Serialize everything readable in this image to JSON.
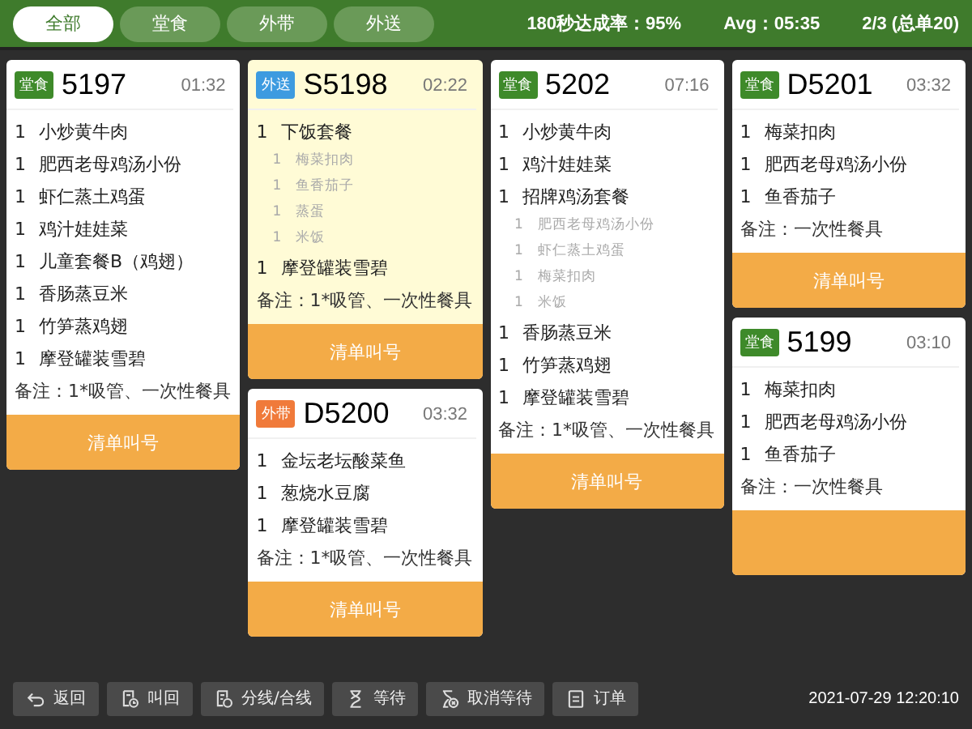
{
  "tabs": [
    {
      "label": "全部",
      "selected": true
    },
    {
      "label": "堂食",
      "selected": false
    },
    {
      "label": "外带",
      "selected": false
    },
    {
      "label": "外送",
      "selected": false
    }
  ],
  "stats": [
    "180秒达成率：95%",
    "Avg：05:35",
    "2/3 (总单20)"
  ],
  "columns": [
    {
      "cards": [
        {
          "tag": "堂食",
          "color": "#3e8a2a",
          "number": "5197",
          "time": "01:32",
          "selected": false,
          "items": [
            {
              "qty": "1",
              "name": "小炒黄牛肉"
            },
            {
              "qty": "1",
              "name": "肥西老母鸡汤小份"
            },
            {
              "qty": "1",
              "name": "虾仁蒸土鸡蛋"
            },
            {
              "qty": "1",
              "name": "鸡汁娃娃菜"
            },
            {
              "qty": "1",
              "name": "儿童套餐B（鸡翅）"
            },
            {
              "qty": "1",
              "name": "香肠蒸豆米"
            },
            {
              "qty": "1",
              "name": "竹笋蒸鸡翅"
            },
            {
              "qty": "1",
              "name": "摩登罐装雪碧"
            }
          ],
          "note": "备注：1*吸管、一次性餐具",
          "button": "清单叫号"
        }
      ]
    },
    {
      "cards": [
        {
          "tag": "外送",
          "color": "#3d9be0",
          "number": "S5198",
          "time": "02:22",
          "selected": true,
          "items": [
            {
              "qty": "1",
              "name": "下饭套餐",
              "children": [
                {
                  "qty": "1",
                  "name": "梅菜扣肉"
                },
                {
                  "qty": "1",
                  "name": "鱼香茄子"
                },
                {
                  "qty": "1",
                  "name": "蒸蛋"
                },
                {
                  "qty": "1",
                  "name": "米饭"
                }
              ]
            },
            {
              "qty": "1",
              "name": "摩登罐装雪碧"
            }
          ],
          "note": "备注：1*吸管、一次性餐具",
          "button": "清单叫号"
        },
        {
          "tag": "外带",
          "color": "#f07a3a",
          "number": "D5200",
          "time": "03:32",
          "selected": false,
          "items": [
            {
              "qty": "1",
              "name": "金坛老坛酸菜鱼"
            },
            {
              "qty": "1",
              "name": "葱烧水豆腐"
            },
            {
              "qty": "1",
              "name": "摩登罐装雪碧"
            }
          ],
          "note": "备注：1*吸管、一次性餐具",
          "button": "清单叫号"
        }
      ]
    },
    {
      "cards": [
        {
          "tag": "堂食",
          "color": "#3e8a2a",
          "number": "5202",
          "time": "07:16",
          "selected": false,
          "items": [
            {
              "qty": "1",
              "name": "小炒黄牛肉"
            },
            {
              "qty": "1",
              "name": "鸡汁娃娃菜"
            },
            {
              "qty": "1",
              "name": "招牌鸡汤套餐",
              "children": [
                {
                  "qty": "1",
                  "name": "肥西老母鸡汤小份"
                },
                {
                  "qty": "1",
                  "name": "虾仁蒸土鸡蛋"
                },
                {
                  "qty": "1",
                  "name": "梅菜扣肉"
                },
                {
                  "qty": "1",
                  "name": "米饭"
                }
              ]
            },
            {
              "qty": "1",
              "name": "香肠蒸豆米"
            },
            {
              "qty": "1",
              "name": "竹笋蒸鸡翅"
            },
            {
              "qty": "1",
              "name": "摩登罐装雪碧"
            }
          ],
          "note": "备注：1*吸管、一次性餐具",
          "button": "清单叫号"
        }
      ]
    },
    {
      "cards": [
        {
          "tag": "堂食",
          "color": "#3e8a2a",
          "number": "D5201",
          "time": "03:32",
          "selected": false,
          "items": [
            {
              "qty": "1",
              "name": "梅菜扣肉"
            },
            {
              "qty": "1",
              "name": "肥西老母鸡汤小份"
            },
            {
              "qty": "1",
              "name": "鱼香茄子"
            }
          ],
          "note": "备注：一次性餐具",
          "button": "清单叫号"
        },
        {
          "tag": "堂食",
          "color": "#3e8a2a",
          "number": "5199",
          "time": "03:10",
          "selected": false,
          "items": [
            {
              "qty": "1",
              "name": "梅菜扣肉"
            },
            {
              "qty": "1",
              "name": "肥西老母鸡汤小份"
            },
            {
              "qty": "1",
              "name": "鱼香茄子"
            }
          ],
          "note": "备注：一次性餐具",
          "button_cut": true
        }
      ]
    }
  ],
  "toolbar": [
    {
      "kind": "back",
      "label": "返回"
    },
    {
      "kind": "recall",
      "label": "叫回"
    },
    {
      "kind": "split",
      "label": "分线/合线"
    },
    {
      "kind": "wait",
      "label": "等待"
    },
    {
      "kind": "unwait",
      "label": "取消等待"
    },
    {
      "kind": "order",
      "label": "订单"
    }
  ],
  "datetime": "2021-07-29 12:20:10"
}
